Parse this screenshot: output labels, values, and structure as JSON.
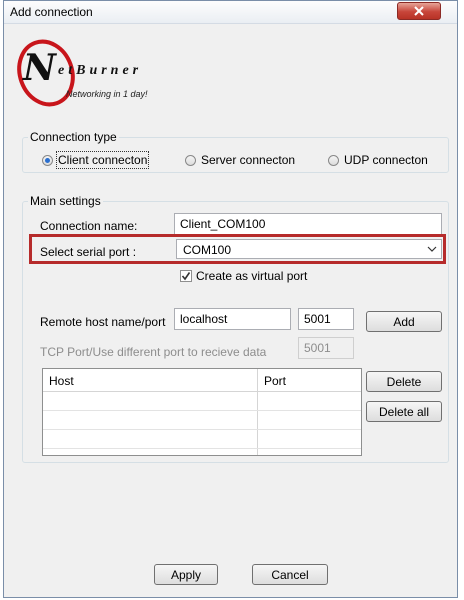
{
  "window": {
    "title": "Add connection",
    "close_glyph": "x"
  },
  "logo": {
    "letter": "N",
    "word": "etBurner",
    "tagline": "Networking in 1 day!"
  },
  "connection_type": {
    "legend": "Connection type",
    "options": [
      {
        "label": "Client connecton",
        "selected": true
      },
      {
        "label": "Server connecton",
        "selected": false
      },
      {
        "label": "UDP connecton",
        "selected": false
      }
    ]
  },
  "main_settings": {
    "legend": "Main settings",
    "connection_name_label": "Connection name:",
    "connection_name_value": "Client_COM100",
    "serial_port_label": "Select serial port :",
    "serial_port_value": "COM100",
    "virtual_port_label": "Create as virtual port",
    "virtual_port_checked": true,
    "remote_host_label": "Remote host name/port",
    "remote_host_value": "localhost",
    "remote_port_value": "5001",
    "add_label": "Add",
    "tcp_port_label": "TCP Port/Use different port to recieve data",
    "tcp_port_value": "5001",
    "table": {
      "columns": [
        "Host",
        "Port"
      ],
      "rows": [
        [
          "",
          ""
        ],
        [
          "",
          ""
        ],
        [
          "",
          ""
        ]
      ]
    },
    "delete_label": "Delete",
    "delete_all_label": "Delete all"
  },
  "footer": {
    "apply_label": "Apply",
    "cancel_label": "Cancel"
  },
  "colors": {
    "highlight_border": "#b62b2b",
    "radio_selected": "#2a6fcf",
    "close_button": "#c7453a"
  }
}
